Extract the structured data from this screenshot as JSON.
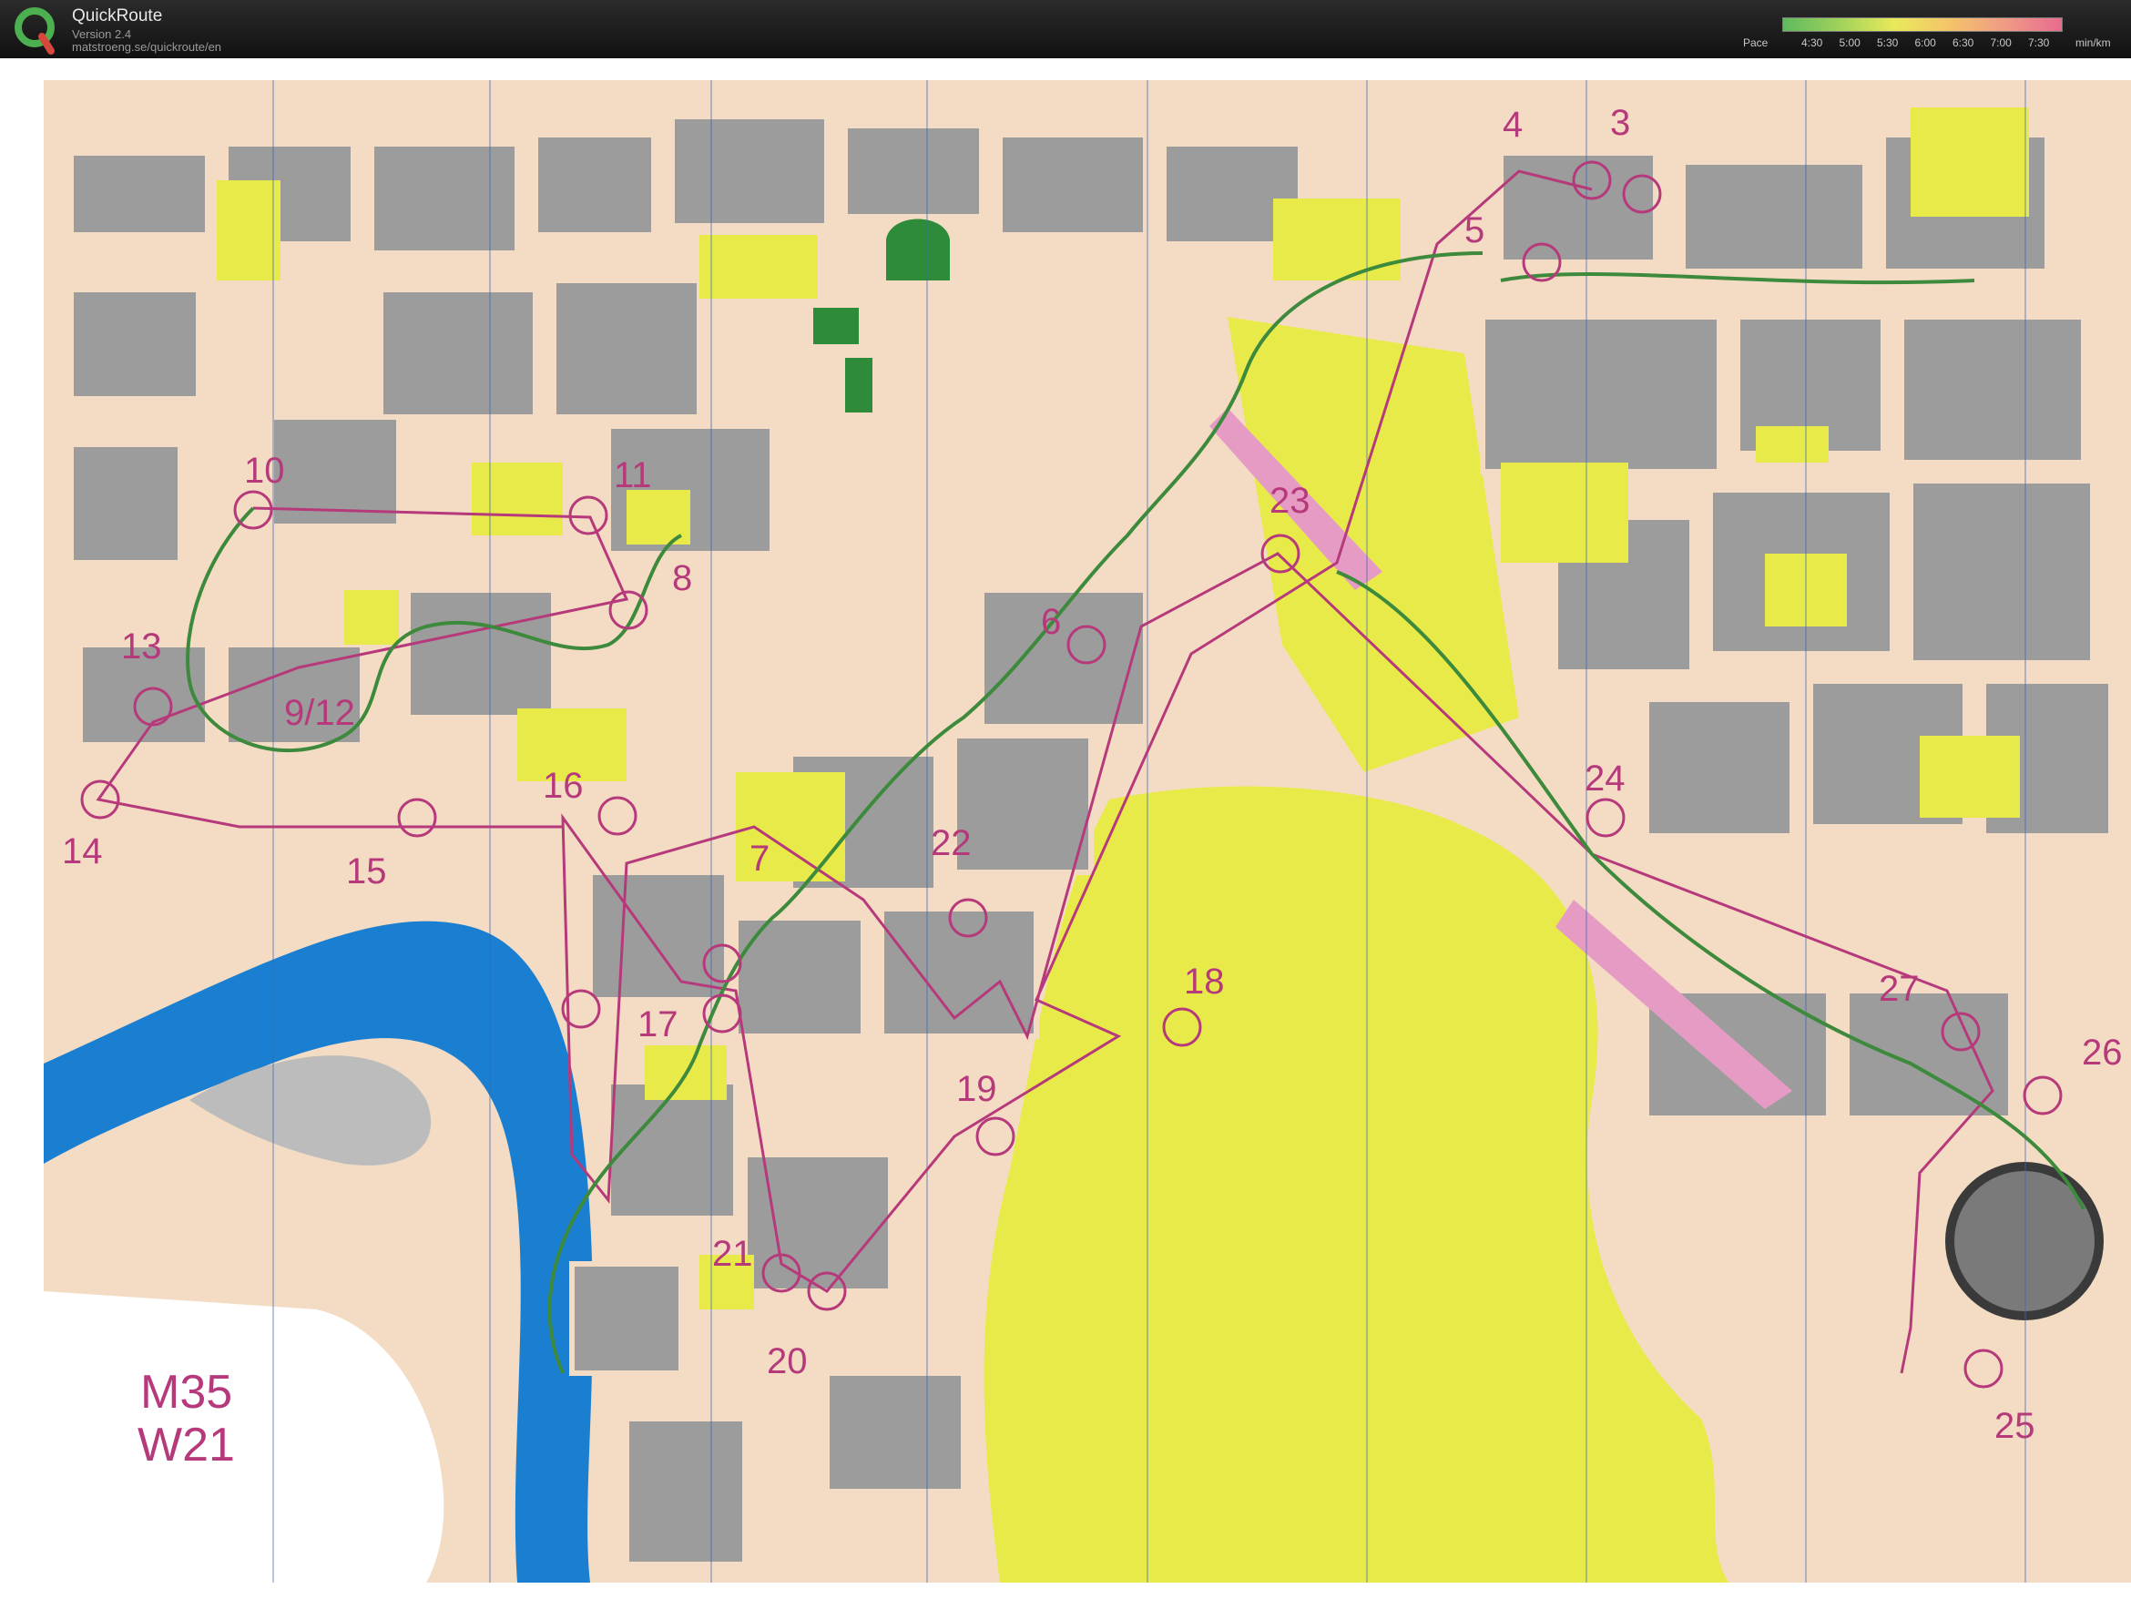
{
  "app": {
    "title": "QuickRoute",
    "version": "Version 2.4",
    "url": "matstroeng.se/quickroute/en"
  },
  "pace_legend": {
    "title": "Pace",
    "unit": "min/km",
    "ticks": [
      "4:30",
      "5:00",
      "5:30",
      "6:00",
      "6:30",
      "7:00",
      "7:30"
    ],
    "colors": [
      "#5fb95f",
      "#9fd25a",
      "#e9e95a",
      "#f4c36a",
      "#f09a86",
      "#e86b8f"
    ]
  },
  "map": {
    "class_labels": [
      "M35",
      "W21"
    ],
    "controls": [
      "3",
      "4",
      "5",
      "6",
      "7",
      "8",
      "9/12",
      "10",
      "11",
      "13",
      "14",
      "15",
      "16",
      "17",
      "18",
      "19",
      "20",
      "21",
      "22",
      "23",
      "24",
      "25",
      "26",
      "27"
    ]
  }
}
